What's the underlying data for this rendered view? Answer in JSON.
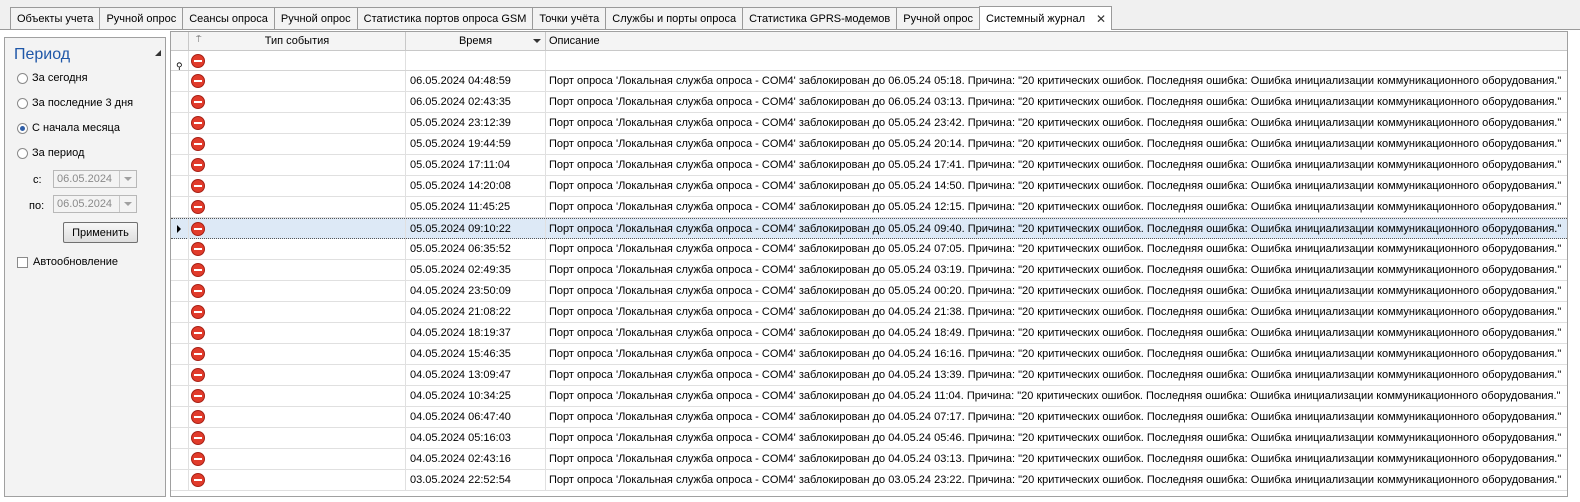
{
  "tabs": [
    {
      "label": "Объекты учета"
    },
    {
      "label": "Ручной опрос"
    },
    {
      "label": "Сеансы опроса"
    },
    {
      "label": "Ручной опрос"
    },
    {
      "label": "Статистика портов опроса GSM"
    },
    {
      "label": "Точки учёта"
    },
    {
      "label": "Службы и порты опроса"
    },
    {
      "label": "Статистика GPRS-модемов"
    },
    {
      "label": "Ручной опрос"
    },
    {
      "label": "Системный журнал",
      "active": true,
      "close": "✕"
    }
  ],
  "period": {
    "title": "Период",
    "options": [
      "За сегодня",
      "За последние 3 дня",
      "С начала месяца",
      "За период"
    ],
    "selected_index": 2,
    "from_label": "с:",
    "from_value": "06.05.2024",
    "to_label": "по:",
    "to_value": "06.05.2024",
    "apply_label": "Применить",
    "autorefresh_label": "Автообновление"
  },
  "grid": {
    "columns": [
      "Тип события",
      "Время",
      "Описание"
    ],
    "event_icon": "stop-error-icon",
    "selected_row": 7,
    "rows": [
      {
        "time": "06.05.2024 04:48:59",
        "desc": "Порт опроса 'Локальная служба опроса - COM4' заблокирован до 06.05.24 05:18. Причина: \"20 критических ошибок. Последняя ошибка: Ошибка инициализации коммуникационного оборудования.\""
      },
      {
        "time": "06.05.2024 02:43:35",
        "desc": "Порт опроса 'Локальная служба опроса - COM4' заблокирован до 06.05.24 03:13. Причина: \"20 критических ошибок. Последняя ошибка: Ошибка инициализации коммуникационного оборудования.\""
      },
      {
        "time": "05.05.2024 23:12:39",
        "desc": "Порт опроса 'Локальная служба опроса - COM4' заблокирован до 05.05.24 23:42. Причина: \"20 критических ошибок. Последняя ошибка: Ошибка инициализации коммуникационного оборудования.\""
      },
      {
        "time": "05.05.2024 19:44:59",
        "desc": "Порт опроса 'Локальная служба опроса - COM4' заблокирован до 05.05.24 20:14. Причина: \"20 критических ошибок. Последняя ошибка: Ошибка инициализации коммуникационного оборудования.\""
      },
      {
        "time": "05.05.2024 17:11:04",
        "desc": "Порт опроса 'Локальная служба опроса - COM4' заблокирован до 05.05.24 17:41. Причина: \"20 критических ошибок. Последняя ошибка: Ошибка инициализации коммуникационного оборудования.\""
      },
      {
        "time": "05.05.2024 14:20:08",
        "desc": "Порт опроса 'Локальная служба опроса - COM4' заблокирован до 05.05.24 14:50. Причина: \"20 критических ошибок. Последняя ошибка: Ошибка инициализации коммуникационного оборудования.\""
      },
      {
        "time": "05.05.2024 11:45:25",
        "desc": "Порт опроса 'Локальная служба опроса - COM4' заблокирован до 05.05.24 12:15. Причина: \"20 критических ошибок. Последняя ошибка: Ошибка инициализации коммуникационного оборудования.\""
      },
      {
        "time": "05.05.2024 09:10:22",
        "desc": "Порт опроса 'Локальная служба опроса - COM4' заблокирован до 05.05.24 09:40. Причина: \"20 критических ошибок. Последняя ошибка: Ошибка инициализации коммуникационного оборудования.\""
      },
      {
        "time": "05.05.2024 06:35:52",
        "desc": "Порт опроса 'Локальная служба опроса - COM4' заблокирован до 05.05.24 07:05. Причина: \"20 критических ошибок. Последняя ошибка: Ошибка инициализации коммуникационного оборудования.\""
      },
      {
        "time": "05.05.2024 02:49:35",
        "desc": "Порт опроса 'Локальная служба опроса - COM4' заблокирован до 05.05.24 03:19. Причина: \"20 критических ошибок. Последняя ошибка: Ошибка инициализации коммуникационного оборудования.\""
      },
      {
        "time": "04.05.2024 23:50:09",
        "desc": "Порт опроса 'Локальная служба опроса - COM4' заблокирован до 05.05.24 00:20. Причина: \"20 критических ошибок. Последняя ошибка: Ошибка инициализации коммуникационного оборудования.\""
      },
      {
        "time": "04.05.2024 21:08:22",
        "desc": "Порт опроса 'Локальная служба опроса - COM4' заблокирован до 04.05.24 21:38. Причина: \"20 критических ошибок. Последняя ошибка: Ошибка инициализации коммуникационного оборудования.\""
      },
      {
        "time": "04.05.2024 18:19:37",
        "desc": "Порт опроса 'Локальная служба опроса - COM4' заблокирован до 04.05.24 18:49. Причина: \"20 критических ошибок. Последняя ошибка: Ошибка инициализации коммуникационного оборудования.\""
      },
      {
        "time": "04.05.2024 15:46:35",
        "desc": "Порт опроса 'Локальная служба опроса - COM4' заблокирован до 04.05.24 16:16. Причина: \"20 критических ошибок. Последняя ошибка: Ошибка инициализации коммуникационного оборудования.\""
      },
      {
        "time": "04.05.2024 13:09:47",
        "desc": "Порт опроса 'Локальная служба опроса - COM4' заблокирован до 04.05.24 13:39. Причина: \"20 критических ошибок. Последняя ошибка: Ошибка инициализации коммуникационного оборудования.\""
      },
      {
        "time": "04.05.2024 10:34:25",
        "desc": "Порт опроса 'Локальная служба опроса - COM4' заблокирован до 04.05.24 11:04. Причина: \"20 критических ошибок. Последняя ошибка: Ошибка инициализации коммуникационного оборудования.\""
      },
      {
        "time": "04.05.2024 06:47:40",
        "desc": "Порт опроса 'Локальная служба опроса - COM4' заблокирован до 04.05.24 07:17. Причина: \"20 критических ошибок. Последняя ошибка: Ошибка инициализации коммуникационного оборудования.\""
      },
      {
        "time": "04.05.2024 05:16:03",
        "desc": "Порт опроса 'Локальная служба опроса - COM4' заблокирован до 04.05.24 05:46. Причина: \"20 критических ошибок. Последняя ошибка: Ошибка инициализации коммуникационного оборудования.\""
      },
      {
        "time": "04.05.2024 02:43:16",
        "desc": "Порт опроса 'Локальная служба опроса - COM4' заблокирован до 04.05.24 03:13. Причина: \"20 критических ошибок. Последняя ошибка: Ошибка инициализации коммуникационного оборудования.\""
      },
      {
        "time": "03.05.2024 22:52:54",
        "desc": "Порт опроса 'Локальная служба опроса - COM4' заблокирован до 03.05.24 23:22. Причина: \"20 критических ошибок. Последняя ошибка: Ошибка инициализации коммуникационного оборудования.\""
      }
    ]
  }
}
